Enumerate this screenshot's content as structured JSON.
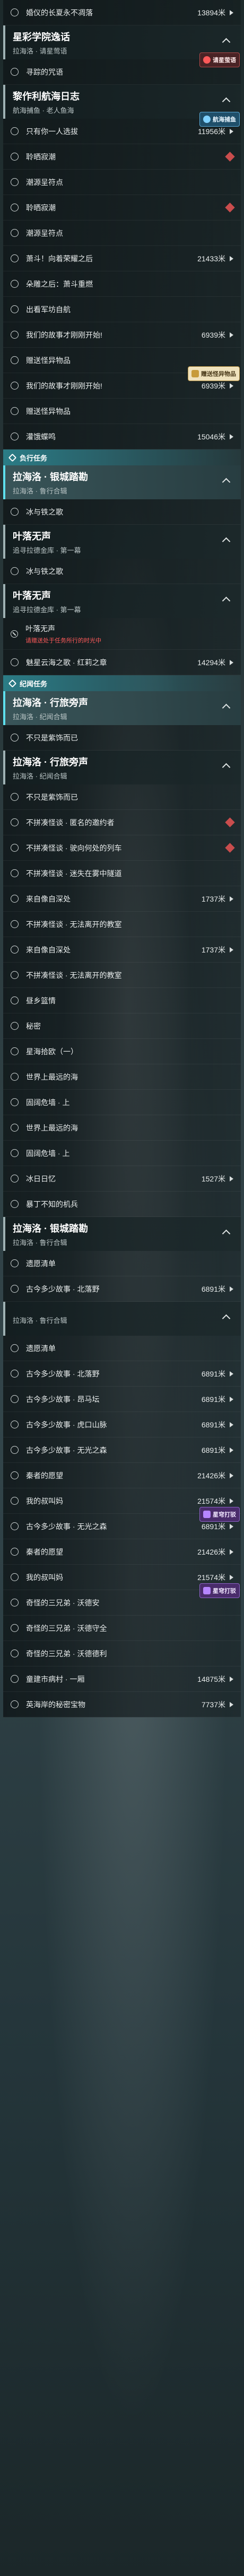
{
  "items": [
    {
      "kind": "quest",
      "text": "婚仪的长夏永不凋落",
      "dist": "13894米",
      "arrow": true,
      "badge": false
    },
    {
      "kind": "header",
      "title": "星彩学院逸话",
      "subtitle": "拉海洛 · 请星莺语",
      "chevron": true,
      "badge": null
    },
    {
      "kind": "quest",
      "text": "寻踪的咒语",
      "dist": "",
      "arrow": false,
      "badge": false
    },
    {
      "kind": "header",
      "title": "黎作利航海日志",
      "subtitle": "航海捕鱼 · 老人鱼海",
      "chevron": true,
      "badge": null
    },
    {
      "kind": "quest",
      "text": "只有你一人选拔",
      "dist": "11956米",
      "arrow": true,
      "badge": false
    },
    {
      "kind": "quest",
      "text": "聆晒寂潮",
      "dist": "",
      "arrow": false,
      "badge": true
    },
    {
      "kind": "quest",
      "text": "潮源呈符点",
      "dist": "",
      "arrow": false,
      "badge": false
    },
    {
      "kind": "quest",
      "text": "聆晒寂潮",
      "dist": "",
      "arrow": false,
      "badge": true
    },
    {
      "kind": "quest",
      "text": "潮源呈符点",
      "dist": "",
      "arrow": false,
      "badge": false
    },
    {
      "kind": "quest",
      "text": "萧斗！向着荣耀之后",
      "dist": "21433米",
      "arrow": true,
      "badge": false
    },
    {
      "kind": "quest",
      "text": "朵雕之后：萧斗重燃",
      "dist": "",
      "arrow": false,
      "badge": false
    },
    {
      "kind": "quest",
      "text": "出看军坊自航",
      "dist": "",
      "arrow": false,
      "badge": false
    },
    {
      "kind": "quest",
      "text": "我们的故事才刚刚开始!",
      "dist": "6939米",
      "arrow": true,
      "badge": false
    },
    {
      "kind": "quest",
      "text": "赠送怪异物品",
      "dist": "",
      "arrow": false,
      "badge": false
    },
    {
      "kind": "quest",
      "text": "我们的故事才刚刚开始!",
      "dist": "6939米",
      "arrow": true,
      "badge": false
    },
    {
      "kind": "quest",
      "text": "赠送怪异物品",
      "dist": "",
      "arrow": false,
      "badge": false
    },
    {
      "kind": "quest",
      "text": "灌饿蝶鸣",
      "dist": "15046米",
      "arrow": true,
      "badge": false
    },
    {
      "kind": "section",
      "title": "负行任务"
    },
    {
      "kind": "header",
      "title": "拉海洛 · 银城踏勘",
      "subtitle": "拉海洛 · 鲁行合辑",
      "chevron": true,
      "badge": null,
      "hl": true
    },
    {
      "kind": "quest",
      "text": "冰与铁之歌",
      "dist": "",
      "arrow": false,
      "badge": false
    },
    {
      "kind": "header",
      "title": "叶落无声",
      "subtitle": "追寻拉德金库 · 第一幕",
      "chevron": true,
      "badge": null
    },
    {
      "kind": "quest",
      "text": "冰与铁之歌",
      "dist": "",
      "arrow": false,
      "badge": false
    },
    {
      "kind": "header",
      "title": "叶落无声",
      "subtitle": "追寻拉德金库 · 第一幕",
      "chevron": true,
      "badge": null
    },
    {
      "kind": "warn",
      "text": "叶落无声",
      "sub": "请赠送处于任务所行的时光中"
    },
    {
      "kind": "quest",
      "text": "魅星云海之歌 · 红莉之章",
      "dist": "14294米",
      "arrow": true,
      "badge": false
    },
    {
      "kind": "section",
      "title": "纪闻任务"
    },
    {
      "kind": "header",
      "title": "拉海洛 · 行旅旁声",
      "subtitle": "拉海洛 · 纪闻合辑",
      "chevron": true,
      "badge": null,
      "hl": true
    },
    {
      "kind": "quest",
      "text": "不只是紫饰而已",
      "dist": "",
      "arrow": false,
      "badge": false
    },
    {
      "kind": "header",
      "title": "拉海洛 · 行旅旁声",
      "subtitle": "拉海洛 · 纪闻合辑",
      "chevron": true,
      "badge": null
    },
    {
      "kind": "quest",
      "text": "不只是紫饰而已",
      "dist": "",
      "arrow": false,
      "badge": false
    },
    {
      "kind": "quest",
      "text": "不拼凑怪谈 · 匿名的邀约者",
      "dist": "",
      "arrow": false,
      "badge": true
    },
    {
      "kind": "quest",
      "text": "不拼凑怪谈 · 驶向何处的列车",
      "dist": "",
      "arrow": false,
      "badge": true
    },
    {
      "kind": "quest",
      "text": "不拼凑怪谈 · 迷失在雾中隧道",
      "dist": "",
      "arrow": false,
      "badge": false
    },
    {
      "kind": "quest",
      "text": "来自像自深处",
      "dist": "1737米",
      "arrow": true,
      "badge": false
    },
    {
      "kind": "quest",
      "text": "不拼凑怪谈 · 无法离开的教室",
      "dist": "",
      "arrow": false,
      "badge": false
    },
    {
      "kind": "quest",
      "text": "来自像自深处",
      "dist": "1737米",
      "arrow": true,
      "badge": false
    },
    {
      "kind": "quest",
      "text": "不拼凑怪谈 · 无法离开的教室",
      "dist": "",
      "arrow": false,
      "badge": false
    },
    {
      "kind": "quest",
      "text": "昼乡篮情",
      "dist": "",
      "arrow": false,
      "badge": false
    },
    {
      "kind": "quest",
      "text": "秘密",
      "dist": "",
      "arrow": false,
      "badge": false
    },
    {
      "kind": "quest",
      "text": "星海拾欧（一）",
      "dist": "",
      "arrow": false,
      "badge": false
    },
    {
      "kind": "quest",
      "text": "世界上最远的海",
      "dist": "",
      "arrow": false,
      "badge": false
    },
    {
      "kind": "quest",
      "text": "固阔危墙 · 上",
      "dist": "",
      "arrow": false,
      "badge": false
    },
    {
      "kind": "quest",
      "text": "世界上最远的海",
      "dist": "",
      "arrow": false,
      "badge": false
    },
    {
      "kind": "quest",
      "text": "固阔危墙 · 上",
      "dist": "",
      "arrow": false,
      "badge": false
    },
    {
      "kind": "quest",
      "text": "冰日日忆",
      "dist": "1527米",
      "arrow": true,
      "badge": false
    },
    {
      "kind": "quest",
      "text": "暴丁不知的机兵",
      "dist": "",
      "arrow": false,
      "badge": false
    },
    {
      "kind": "header",
      "title": "拉海洛 · 银城踏勘",
      "subtitle": "拉海洛 · 鲁行合辑",
      "chevron": true,
      "badge": null
    },
    {
      "kind": "quest",
      "text": "遗愿清单",
      "dist": "",
      "arrow": false,
      "badge": false
    },
    {
      "kind": "quest",
      "text": "古今多少故事 · 北落野",
      "dist": "6891米",
      "arrow": true,
      "badge": false
    },
    {
      "kind": "header",
      "title": "",
      "subtitle": "拉海洛 · 鲁行合辑",
      "chevron": true,
      "badge": null
    },
    {
      "kind": "quest",
      "text": "遗愿清单",
      "dist": "",
      "arrow": false,
      "badge": false
    },
    {
      "kind": "quest",
      "text": "古今多少故事 · 北落野",
      "dist": "6891米",
      "arrow": true,
      "badge": false
    },
    {
      "kind": "quest",
      "text": "古今多少故事 · 昂马坛",
      "dist": "6891米",
      "arrow": true,
      "badge": false
    },
    {
      "kind": "quest",
      "text": "古今多少故事 · 虎口山脉",
      "dist": "6891米",
      "arrow": true,
      "badge": false
    },
    {
      "kind": "quest",
      "text": "古今多少故事 · 无光之森",
      "dist": "6891米",
      "arrow": true,
      "badge": false
    },
    {
      "kind": "quest",
      "text": "秦者的愿望",
      "dist": "21426米",
      "arrow": true,
      "badge": false
    },
    {
      "kind": "quest",
      "text": "我的叔叫妈",
      "dist": "21574米",
      "arrow": true,
      "badge": false
    },
    {
      "kind": "quest",
      "text": "古今多少故事 · 无光之森",
      "dist": "6891米",
      "arrow": true,
      "badge": false
    },
    {
      "kind": "quest",
      "text": "秦者的愿望",
      "dist": "21426米",
      "arrow": true,
      "badge": false
    },
    {
      "kind": "quest",
      "text": "我的叔叫妈",
      "dist": "21574米",
      "arrow": true,
      "badge": false
    },
    {
      "kind": "quest",
      "text": "奇怪的三兄弟 · 沃德安",
      "dist": "",
      "arrow": false,
      "badge": false
    },
    {
      "kind": "quest",
      "text": "奇怪的三兄弟 · 沃德守全",
      "dist": "",
      "arrow": false,
      "badge": false
    },
    {
      "kind": "quest",
      "text": "奇怪的三兄弟 · 沃德德利",
      "dist": "",
      "arrow": false,
      "badge": false
    },
    {
      "kind": "quest",
      "text": "童建市病村 · 一厢",
      "dist": "14875米",
      "arrow": true,
      "badge": false
    },
    {
      "kind": "quest",
      "text": "英海岸的秘密宝物",
      "dist": "7737米",
      "arrow": true,
      "badge": false
    }
  ],
  "floaters": [
    {
      "label": "请星萤语",
      "style": "red",
      "after": 1
    },
    {
      "label": "航海捕鱼",
      "style": "blue",
      "after": 3
    },
    {
      "label": "赠送怪异物品",
      "style": "gold",
      "after": 13
    },
    {
      "label": "星穹打驳",
      "style": "purple",
      "after": 56
    },
    {
      "label": "星穹打驳",
      "style": "purple",
      "after": 59
    }
  ]
}
